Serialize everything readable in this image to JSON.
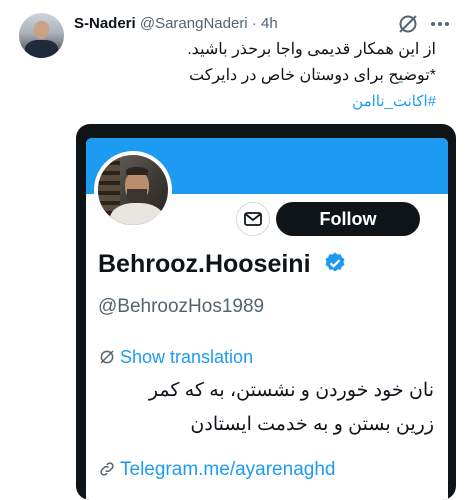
{
  "tweet": {
    "display_name": "S-Naderi",
    "handle": "@SarangNaderi",
    "separator": "·",
    "time": "4h",
    "text_line_1": "از این همکار قدیمی واجا برحذر باشید.",
    "text_line_2": "*توضیح برای دوستان خاص در دایرکت",
    "hashtag": "#اکانت_ناامن",
    "icons": {
      "avatar": "user-avatar",
      "grok": "grok-icon",
      "more": "more-options-icon"
    }
  },
  "embedded_profile": {
    "display_name": "Behrooz.Hooseini",
    "handle": "@BehroozHos1989",
    "follow_label": "Follow",
    "show_translation_label": "Show translation",
    "bio_line_1": "نان خود خوردن و نشستن، به که کمر",
    "bio_line_2": "زرین بستن و به خدمت ایستادن",
    "link_text": "Telegram.me/ayarenaghd",
    "icons": {
      "message": "message-envelope-icon",
      "verified": "verified-badge-icon",
      "translate": "translate-icon",
      "link": "link-icon"
    }
  },
  "colors": {
    "accent": "#1d9bf0",
    "text": "#0f1419",
    "muted": "#536471",
    "frame": "#0f1419"
  }
}
